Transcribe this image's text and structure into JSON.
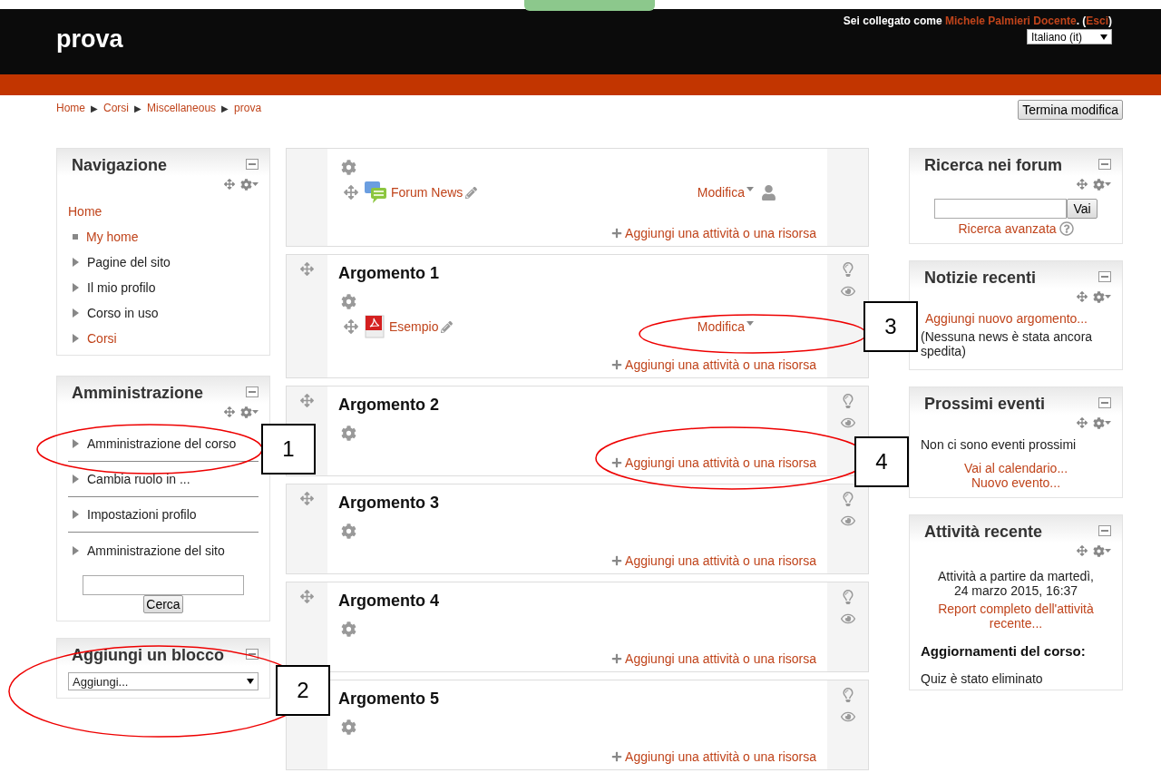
{
  "header": {
    "site_title": "prova",
    "login_prefix": "Sei collegato come",
    "user_name": "Michele Palmieri Docente",
    "punct_open": ". (",
    "logout": "Esci",
    "punct_close": ")",
    "language": "Italiano (it)"
  },
  "breadcrumb": [
    {
      "label": "Home"
    },
    {
      "separator": "▶",
      "label": "Corsi"
    },
    {
      "separator": "▶",
      "label": "Miscellaneous"
    },
    {
      "separator": "▶",
      "label": "prova"
    }
  ],
  "edit_button": "Termina modifica",
  "navigation": {
    "title": "Navigazione",
    "items": [
      {
        "label": "Home",
        "kind": "root",
        "link": true
      },
      {
        "label": "My home",
        "kind": "leaf",
        "link": true
      },
      {
        "label": "Pagine del sito",
        "kind": "branch",
        "link": false
      },
      {
        "label": "Il mio profilo",
        "kind": "branch",
        "link": false
      },
      {
        "label": "Corso in uso",
        "kind": "branch",
        "link": false
      },
      {
        "label": "Corsi",
        "kind": "branch",
        "link": true
      }
    ]
  },
  "administration": {
    "title": "Amministrazione",
    "items": [
      "Amministrazione del corso",
      "Cambia ruolo in ...",
      "Impostazioni profilo",
      "Amministrazione del sito"
    ],
    "search_button": "Cerca"
  },
  "add_block": {
    "title": "Aggiungi un blocco",
    "select": "Aggiungi..."
  },
  "sections": [
    {
      "movable": false,
      "activities": [
        {
          "kind": "forum",
          "name": "Forum News",
          "menu": "Modifica",
          "role_icon": true
        }
      ],
      "add_label": "Aggiungi una attività o una risorsa"
    },
    {
      "title": "Argomento 1",
      "movable": true,
      "activities": [
        {
          "kind": "pdf",
          "name": "Esempio",
          "menu": "Modifica",
          "role_icon": false
        }
      ],
      "add_label": "Aggiungi una attività o una risorsa"
    },
    {
      "title": "Argomento 2",
      "movable": true,
      "add_label": "Aggiungi una attività o una risorsa"
    },
    {
      "title": "Argomento 3",
      "movable": true,
      "add_label": "Aggiungi una attività o una risorsa"
    },
    {
      "title": "Argomento 4",
      "movable": true,
      "add_label": "Aggiungi una attività o una risorsa"
    },
    {
      "title": "Argomento 5",
      "add_label": "Aggiungi una attività o una risorsa"
    }
  ],
  "forum_search": {
    "title": "Ricerca nei forum",
    "button": "Vai",
    "advanced": "Ricerca avanzata"
  },
  "news": {
    "title": "Notizie recenti",
    "add_link": "Aggiungi nuovo argomento...",
    "empty": "(Nessuna news è stata ancora spedita)"
  },
  "events": {
    "title": "Prossimi eventi",
    "empty": "Non ci sono eventi prossimi",
    "links": [
      "Vai al calendario...",
      "Nuovo evento..."
    ]
  },
  "recent_activity": {
    "title": "Attività recente",
    "since": "Attività a partire da martedì, 24 marzo 2015, 16:37",
    "report_link": "Report completo dell'attività recente...",
    "updates_heading": "Aggiornamenti del corso:",
    "updates": [
      "Quiz è stato eliminato"
    ]
  },
  "callouts": [
    "1",
    "2",
    "3",
    "4"
  ]
}
